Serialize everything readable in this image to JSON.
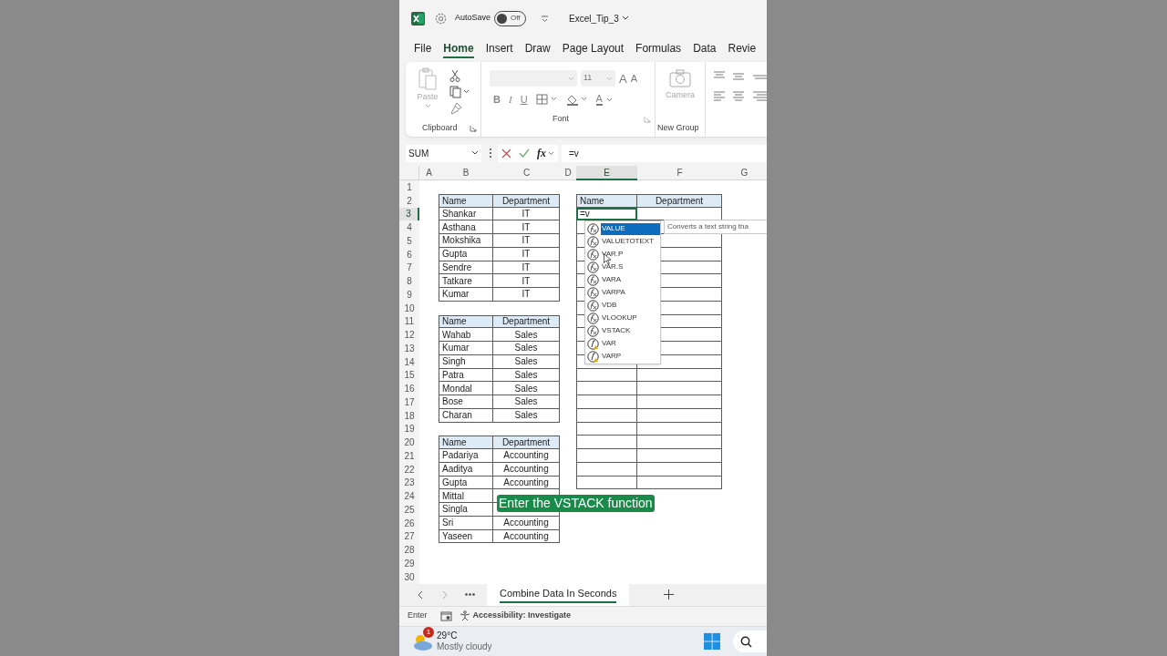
{
  "title_bar": {
    "autosave_label": "AutoSave",
    "autosave": {
      "on": false,
      "label": "Off"
    },
    "file_name": "Excel_Tip_3"
  },
  "menu_tabs": [
    {
      "label": "File",
      "selected": false
    },
    {
      "label": "Home",
      "selected": true
    },
    {
      "label": "Insert",
      "selected": false
    },
    {
      "label": "Draw",
      "selected": false
    },
    {
      "label": "Page Layout",
      "selected": false
    },
    {
      "label": "Formulas",
      "selected": false
    },
    {
      "label": "Data",
      "selected": false
    },
    {
      "label": "Revie",
      "selected": false
    }
  ],
  "ribbon": {
    "paste_label": "Paste",
    "clipboard_label": "Clipboard",
    "font_label": "Font",
    "font_size": "11",
    "grow_font": "A",
    "shrink_font": "A",
    "bold": "B",
    "italic": "I",
    "underline": "U",
    "font_color": "A",
    "camera_label": "Camera",
    "new_group_label": "New Group"
  },
  "formula_bar": {
    "name_box": "SUM",
    "function_label": "fx",
    "formula": "=v"
  },
  "columns": [
    {
      "label": "A",
      "selected": false
    },
    {
      "label": "B",
      "selected": false
    },
    {
      "label": "C",
      "selected": false
    },
    {
      "label": "D",
      "selected": false
    },
    {
      "label": "E",
      "selected": true
    },
    {
      "label": "F",
      "selected": false
    },
    {
      "label": "G",
      "selected": false
    }
  ],
  "row_headers": [
    {
      "label": "1",
      "selected": false
    },
    {
      "label": "2",
      "selected": false
    },
    {
      "label": "3",
      "selected": true
    },
    {
      "label": "4",
      "selected": false
    },
    {
      "label": "5",
      "selected": false
    },
    {
      "label": "6",
      "selected": false
    },
    {
      "label": "7",
      "selected": false
    },
    {
      "label": "8",
      "selected": false
    },
    {
      "label": "9",
      "selected": false
    },
    {
      "label": "10",
      "selected": false
    },
    {
      "label": "11",
      "selected": false
    },
    {
      "label": "12",
      "selected": false
    },
    {
      "label": "13",
      "selected": false
    },
    {
      "label": "14",
      "selected": false
    },
    {
      "label": "15",
      "selected": false
    },
    {
      "label": "16",
      "selected": false
    },
    {
      "label": "17",
      "selected": false
    },
    {
      "label": "18",
      "selected": false
    },
    {
      "label": "19",
      "selected": false
    },
    {
      "label": "20",
      "selected": false
    },
    {
      "label": "21",
      "selected": false
    },
    {
      "label": "22",
      "selected": false
    },
    {
      "label": "23",
      "selected": false
    },
    {
      "label": "24",
      "selected": false
    },
    {
      "label": "25",
      "selected": false
    },
    {
      "label": "26",
      "selected": false
    },
    {
      "label": "27",
      "selected": false
    },
    {
      "label": "28",
      "selected": false
    },
    {
      "label": "29",
      "selected": false
    },
    {
      "label": "30",
      "selected": false
    }
  ],
  "source_tables": [
    {
      "header": [
        "Name",
        "Department"
      ],
      "rows": [
        [
          "Shankar",
          "IT"
        ],
        [
          "Asthana",
          "IT"
        ],
        [
          "Mokshika",
          "IT"
        ],
        [
          "Gupta",
          "IT"
        ],
        [
          "Sendre",
          "IT"
        ],
        [
          "Tatkare",
          "IT"
        ],
        [
          "Kumar",
          "IT"
        ]
      ]
    },
    {
      "header": [
        "Name",
        "Department"
      ],
      "rows": [
        [
          "Wahab",
          "Sales"
        ],
        [
          "Kumar",
          "Sales"
        ],
        [
          "Singh",
          "Sales"
        ],
        [
          "Patra",
          "Sales"
        ],
        [
          "Mondal",
          "Sales"
        ],
        [
          "Bose",
          "Sales"
        ],
        [
          "Charan",
          "Sales"
        ]
      ]
    },
    {
      "header": [
        "Name",
        "Department"
      ],
      "rows": [
        [
          "Padariya",
          "Accounting"
        ],
        [
          "Aaditya",
          "Accounting"
        ],
        [
          "Gupta",
          "Accounting"
        ],
        [
          "Mittal"
        ],
        [
          "Singla"
        ],
        [
          "Sri",
          "Accounting"
        ],
        [
          "Yaseen",
          "Accounting"
        ]
      ]
    }
  ],
  "output_table": {
    "header": [
      "Name",
      "Department"
    ],
    "editing_cell": "=v"
  },
  "autocomplete": {
    "items": [
      {
        "label": "VALUE",
        "kind": "function",
        "selected": true
      },
      {
        "label": "VALUETOTEXT",
        "kind": "function",
        "selected": false
      },
      {
        "label": "VAR.P",
        "kind": "function",
        "selected": false
      },
      {
        "label": "VAR.S",
        "kind": "function",
        "selected": false
      },
      {
        "label": "VARA",
        "kind": "function",
        "selected": false
      },
      {
        "label": "VARPA",
        "kind": "function",
        "selected": false
      },
      {
        "label": "VDB",
        "kind": "function",
        "selected": false
      },
      {
        "label": "VLOOKUP",
        "kind": "function",
        "selected": false
      },
      {
        "label": "VSTACK",
        "kind": "function",
        "selected": false
      },
      {
        "label": "VAR",
        "kind": "compatibility",
        "selected": false
      },
      {
        "label": "VARP",
        "kind": "compatibility",
        "selected": false
      }
    ],
    "tooltip": "Converts a text string tha"
  },
  "caption": "Enter the VSTACK function",
  "sheet_tabs": [
    {
      "label": "Combine Data In Seconds",
      "selected": true
    }
  ],
  "status_bar": {
    "mode": "Enter",
    "accessibility": "Accessibility: Investigate"
  },
  "taskbar": {
    "badge": "1",
    "temperature": "29°C",
    "condition": "Mostly cloudy"
  }
}
